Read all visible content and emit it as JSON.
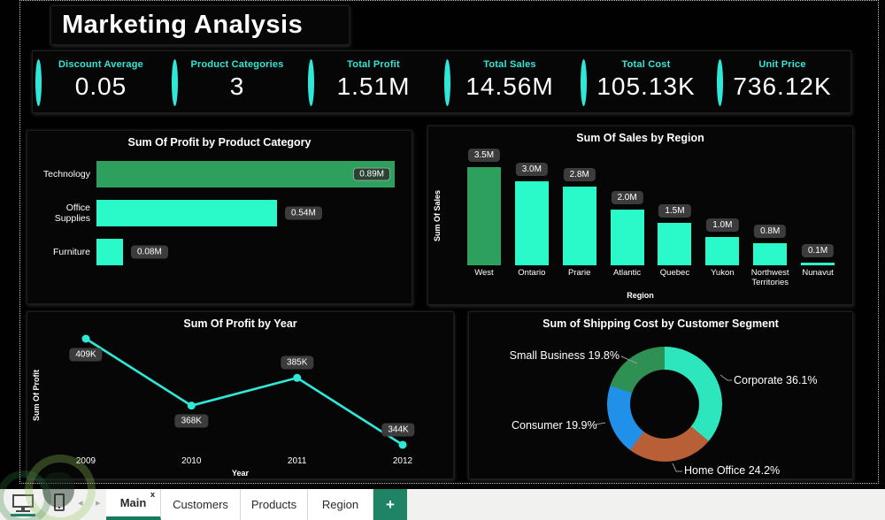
{
  "app": {
    "title": "Marketing Analysis"
  },
  "colors": {
    "accent_cyan": "#2ee8d8",
    "bar_turquoise": "#2afac9",
    "bar_green": "#2ca05c",
    "line_cyan": "#2fe8d8",
    "label_pill_bg": "#3c3c3c",
    "tab_green": "#1f8465",
    "active_tab_underline": "#177a5e",
    "donut_corporate": "#2ee6be",
    "donut_home_office": "#b85f38",
    "donut_consumer": "#2190e8",
    "donut_small_business": "#2e9153"
  },
  "kpis": [
    {
      "label": "Discount Average",
      "value": "0.05"
    },
    {
      "label": "Product Categories",
      "value": "3"
    },
    {
      "label": "Total Profit",
      "value": "1.51M"
    },
    {
      "label": "Total Sales",
      "value": "14.56M"
    },
    {
      "label": "Total Cost",
      "value": "105.13K"
    },
    {
      "label": "Unit Price",
      "value": "736.12K"
    }
  ],
  "chart_data": [
    {
      "id": "profit_by_product_category",
      "type": "bar",
      "orientation": "horizontal",
      "title": "Sum Of Profit by Product Category",
      "categories": [
        "Technology",
        "Office Supplies",
        "Furniture"
      ],
      "values": [
        0.89,
        0.54,
        0.08
      ],
      "value_labels": [
        "0.89M",
        "0.54M",
        "0.08M"
      ],
      "unit": "M",
      "xlim": [
        0,
        0.92
      ],
      "grid": false,
      "bar_color_keys": [
        "bar_green",
        "bar_turquoise",
        "bar_turquoise"
      ],
      "label_inside": [
        true,
        false,
        false
      ]
    },
    {
      "id": "sales_by_region",
      "type": "bar",
      "orientation": "vertical",
      "title": "Sum Of Sales by Region",
      "xlabel": "Region",
      "ylabel": "Sum Of Sales",
      "categories": [
        "West",
        "Ontario",
        "Prarie",
        "Atlantic",
        "Quebec",
        "Yukon",
        "Northwest Territories",
        "Nunavut"
      ],
      "values": [
        3.5,
        3.0,
        2.8,
        2.0,
        1.5,
        1.0,
        0.8,
        0.1
      ],
      "value_labels": [
        "3.5M",
        "3.0M",
        "2.8M",
        "2.0M",
        "1.5M",
        "1.0M",
        "0.8M",
        "0.1M"
      ],
      "unit": "M",
      "ylim": [
        0,
        3.9
      ],
      "grid": false,
      "bar_color_keys": [
        "bar_green",
        "bar_turquoise",
        "bar_turquoise",
        "bar_turquoise",
        "bar_turquoise",
        "bar_turquoise",
        "bar_turquoise",
        "bar_turquoise"
      ]
    },
    {
      "id": "profit_by_year",
      "type": "line",
      "title": "Sum Of Profit by Year",
      "xlabel": "Year",
      "ylabel": "Sum Of Profit",
      "x": [
        "2009",
        "2010",
        "2011",
        "2012"
      ],
      "values": [
        409,
        368,
        385,
        344
      ],
      "value_labels": [
        "409K",
        "368K",
        "385K",
        "344K"
      ],
      "unit": "K",
      "ylim": [
        330,
        420
      ],
      "grid": false,
      "legend": false
    },
    {
      "id": "shipping_cost_by_customer_segment",
      "type": "pie",
      "subtype": "donut",
      "title": "Sum of Shipping Cost by Customer Segment",
      "slices": [
        {
          "label": "Corporate",
          "pct": 36.1,
          "display": "Corporate 36.1%",
          "color_key": "donut_corporate"
        },
        {
          "label": "Home Office",
          "pct": 24.2,
          "display": "Home Office 24.2%",
          "color_key": "donut_home_office"
        },
        {
          "label": "Consumer",
          "pct": 19.9,
          "display": "Consumer 19.9%",
          "color_key": "donut_consumer"
        },
        {
          "label": "Small Business",
          "pct": 19.8,
          "display": "Small Business 19.8%",
          "color_key": "donut_small_business"
        }
      ],
      "legend": "data labels with leader lines"
    }
  ],
  "footer": {
    "tabs": [
      {
        "label": "Main",
        "active": true,
        "close_glyph": "x"
      },
      {
        "label": "Customers",
        "active": false
      },
      {
        "label": "Products",
        "active": false
      },
      {
        "label": "Region",
        "active": false
      }
    ],
    "add_tab_glyph": "+",
    "prev_glyph": "◂",
    "next_glyph": "▸"
  }
}
